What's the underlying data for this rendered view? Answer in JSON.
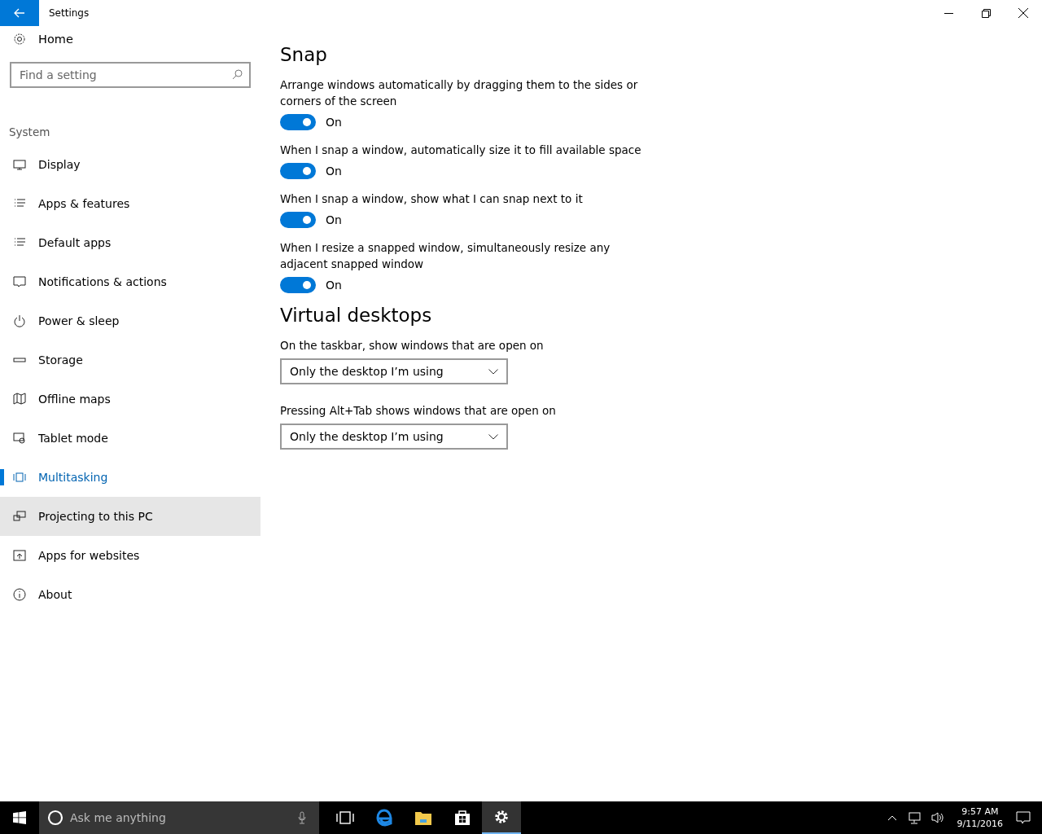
{
  "window": {
    "title": "Settings"
  },
  "sidebar": {
    "home": "Home",
    "search": {
      "placeholder": "Find a setting"
    },
    "group": "System",
    "items": [
      {
        "label": "Display",
        "selected": false,
        "hovered": false
      },
      {
        "label": "Apps & features",
        "selected": false,
        "hovered": false
      },
      {
        "label": "Default apps",
        "selected": false,
        "hovered": false
      },
      {
        "label": "Notifications & actions",
        "selected": false,
        "hovered": false
      },
      {
        "label": "Power & sleep",
        "selected": false,
        "hovered": false
      },
      {
        "label": "Storage",
        "selected": false,
        "hovered": false
      },
      {
        "label": "Offline maps",
        "selected": false,
        "hovered": false
      },
      {
        "label": "Tablet mode",
        "selected": false,
        "hovered": false
      },
      {
        "label": "Multitasking",
        "selected": true,
        "hovered": false
      },
      {
        "label": "Projecting to this PC",
        "selected": false,
        "hovered": true
      },
      {
        "label": "Apps for websites",
        "selected": false,
        "hovered": false
      },
      {
        "label": "About",
        "selected": false,
        "hovered": false
      }
    ]
  },
  "sections": [
    {
      "heading": "Snap",
      "settings": [
        {
          "kind": "toggle",
          "label": "Arrange windows automatically by dragging them to the sides or corners of the screen",
          "on": true,
          "state": "On"
        },
        {
          "kind": "toggle",
          "label": "When I snap a window, automatically size it to fill available space",
          "on": true,
          "state": "On"
        },
        {
          "kind": "toggle",
          "label": "When I snap a window, show what I can snap next to it",
          "on": true,
          "state": "On"
        },
        {
          "kind": "toggle",
          "label": "When I resize a snapped window, simultaneously resize any adjacent snapped window",
          "on": true,
          "state": "On"
        }
      ]
    },
    {
      "heading": "Virtual desktops",
      "settings": [
        {
          "kind": "dropdown",
          "label": "On the taskbar, show windows that are open on",
          "value": "Only the desktop I’m using"
        },
        {
          "kind": "dropdown",
          "label": "Pressing Alt+Tab shows windows that are open on",
          "value": "Only the desktop I’m using"
        }
      ]
    }
  ],
  "taskbar": {
    "search": {
      "placeholder": "Ask me anything"
    },
    "apps": [
      {
        "selected": false
      },
      {
        "selected": false
      },
      {
        "selected": false
      },
      {
        "selected": false
      },
      {
        "selected": true
      }
    ],
    "time": "9:57 AM",
    "date": "9/11/2016"
  }
}
